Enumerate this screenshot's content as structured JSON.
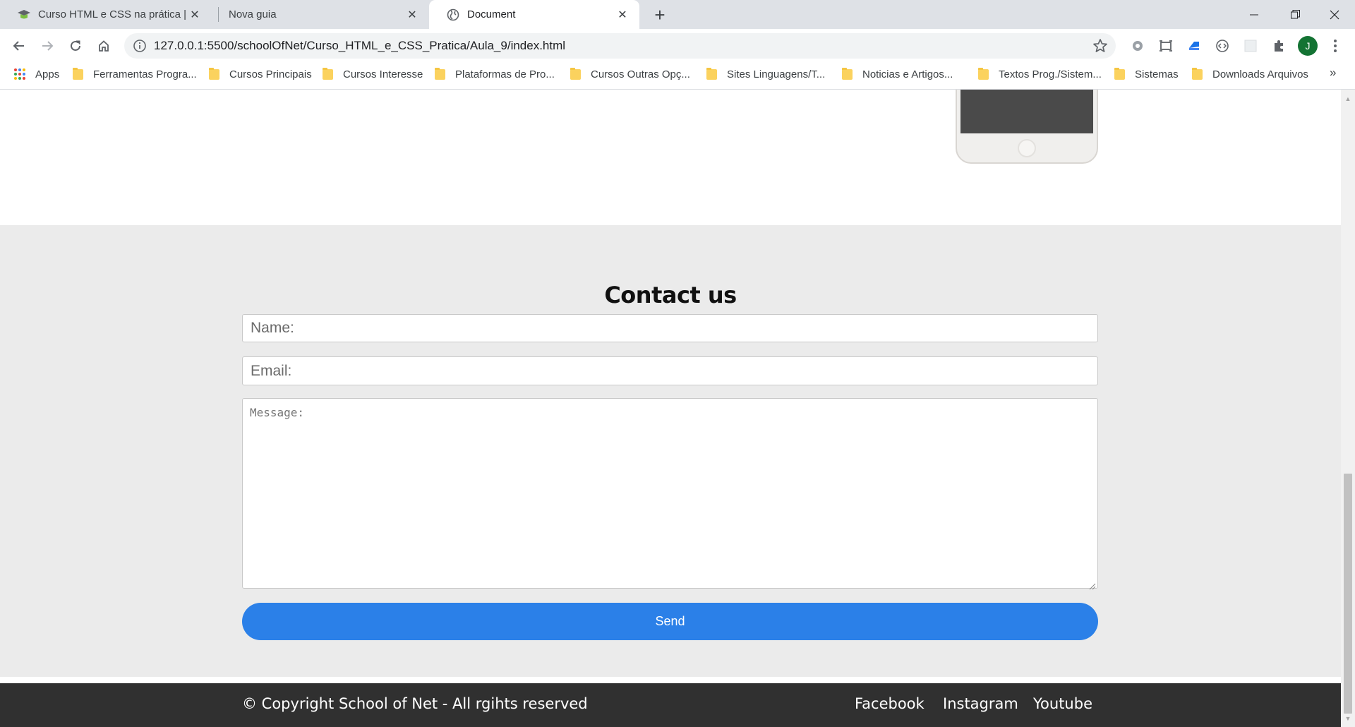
{
  "browser": {
    "tabs": [
      {
        "title": "Curso HTML e CSS na prática | Al",
        "active": false
      },
      {
        "title": "Nova guia",
        "active": false
      },
      {
        "title": "Document",
        "active": true
      }
    ],
    "url": "127.0.0.1:5500/schoolOfNet/Curso_HTML_e_CSS_Pratica/Aula_9/index.html",
    "profile_initial": "J",
    "bookmarks": [
      "Apps",
      "Ferramentas Progra...",
      "Cursos Principais",
      "Cursos Interesse",
      "Plataformas de Pro...",
      "Cursos Outras Opç...",
      "Sites Linguagens/T...",
      "Noticias e Artigos...",
      "Textos Prog./Sistem...",
      "Sistemas",
      "Downloads Arquivos"
    ],
    "bookmarks_more": "»"
  },
  "contact": {
    "title": "Contact us",
    "name_placeholder": "Name:",
    "email_placeholder": "Email:",
    "message_placeholder": "Message:",
    "send_label": "Send"
  },
  "footer": {
    "copyright": "© Copyright School of Net - All rgihts reserved",
    "links": [
      "Facebook",
      "Instagram",
      "Youtube"
    ]
  },
  "colors": {
    "accent": "#2b80e8",
    "contact_bg": "#ebebeb",
    "footer_bg": "#303030"
  }
}
